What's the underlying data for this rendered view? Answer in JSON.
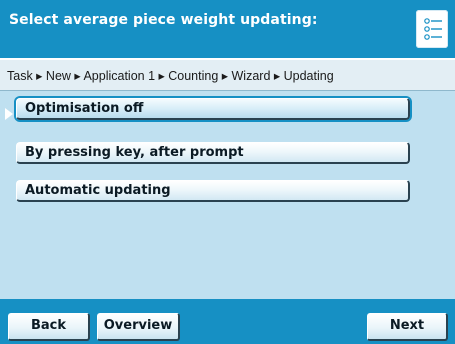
{
  "header": {
    "title": "Select average piece weight updating:",
    "menu_icon": "list-menu-icon"
  },
  "breadcrumb": {
    "path": "Task ▸ New ▸ Application 1 ▸ Counting ▸ Wizard ▸ Updating"
  },
  "options": [
    {
      "label": "Optimisation off",
      "selected": true
    },
    {
      "label": "By pressing key, after prompt",
      "selected": false
    },
    {
      "label": "Automatic updating",
      "selected": false
    }
  ],
  "footer": {
    "back_label": "Back",
    "overview_label": "Overview",
    "next_label": "Next"
  },
  "colors": {
    "header_bg": "#1690c4",
    "content_bg": "#bfe0f0",
    "breadcrumb_bg": "#e3eef4"
  }
}
